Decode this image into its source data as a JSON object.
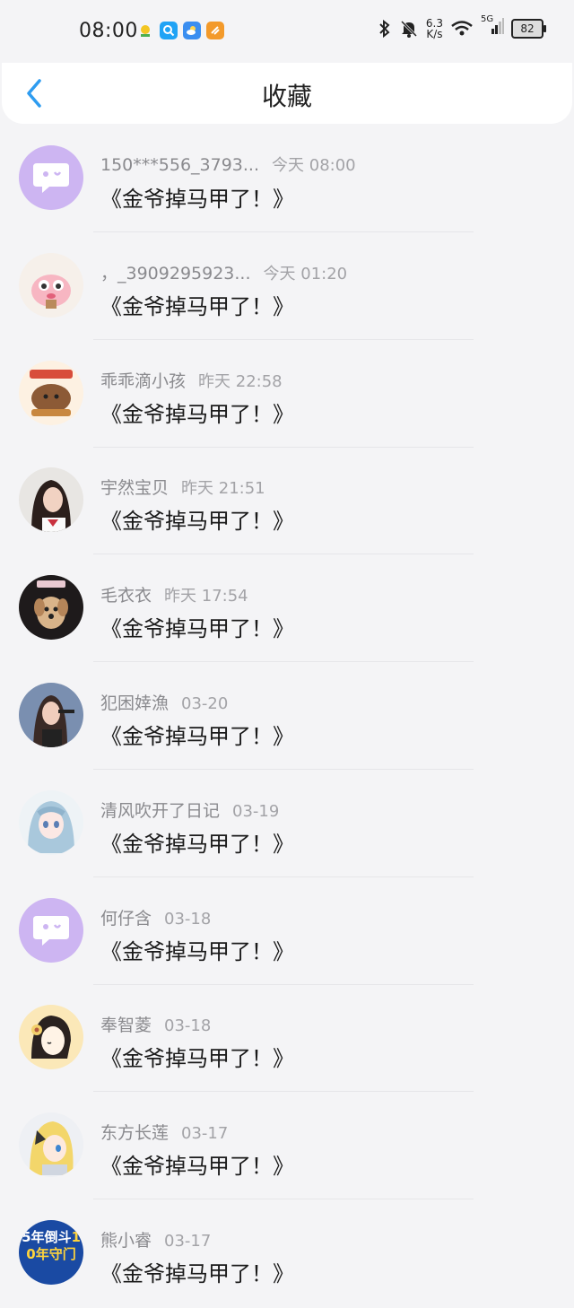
{
  "status_bar": {
    "time": "08:00",
    "net_speed_top": "6.3",
    "net_speed_bottom": "K/s",
    "signal": "5G",
    "battery": "82",
    "icons": [
      "bluetooth-icon",
      "mute-icon",
      "wifi-icon",
      "signal-icon"
    ]
  },
  "header": {
    "title": "收藏",
    "back_icon": "chevron-left-icon"
  },
  "colors": {
    "accent": "#2e9cf0",
    "background": "#f4f4f6",
    "chat_avatar": "#cdb5f2"
  },
  "items": [
    {
      "name": "150***556_3793...",
      "time": "今天 08:00",
      "message": "《金爷掉马甲了！》",
      "avatar": "chat-bubble-icon"
    },
    {
      "name": "，_3909295923...",
      "time": "今天 01:20",
      "message": "《金爷掉马甲了！》",
      "avatar": "pink-character"
    },
    {
      "name": "乖乖滴小孩",
      "time": "昨天 22:58",
      "message": "《金爷掉马甲了！》",
      "avatar": "bear-sticker"
    },
    {
      "name": "宇然宝贝",
      "time": "昨天 21:51",
      "message": "《金爷掉马甲了！》",
      "avatar": "girl-photo"
    },
    {
      "name": "毛衣衣",
      "time": "昨天 17:54",
      "message": "《金爷掉马甲了！》",
      "avatar": "dog-photo"
    },
    {
      "name": "犯困婞漁",
      "time": "03-20",
      "message": "《金爷掉马甲了！》",
      "avatar": "girl-photo-2"
    },
    {
      "name": "清风吹开了日记",
      "time": "03-19",
      "message": "《金爷掉马甲了！》",
      "avatar": "anime-girl"
    },
    {
      "name": "何仔含",
      "time": "03-18",
      "message": "《金爷掉马甲了！》",
      "avatar": "chat-bubble-icon"
    },
    {
      "name": "奉智菱",
      "time": "03-18",
      "message": "《金爷掉马甲了！》",
      "avatar": "flower-girl"
    },
    {
      "name": "东方长莲",
      "time": "03-17",
      "message": "《金爷掉马甲了！》",
      "avatar": "anime-blonde"
    },
    {
      "name": "熊小睿",
      "time": "03-17",
      "message": "《金爷掉马甲了！》",
      "avatar": "poster",
      "avatar_text": "5年倒斗10年守门"
    }
  ]
}
